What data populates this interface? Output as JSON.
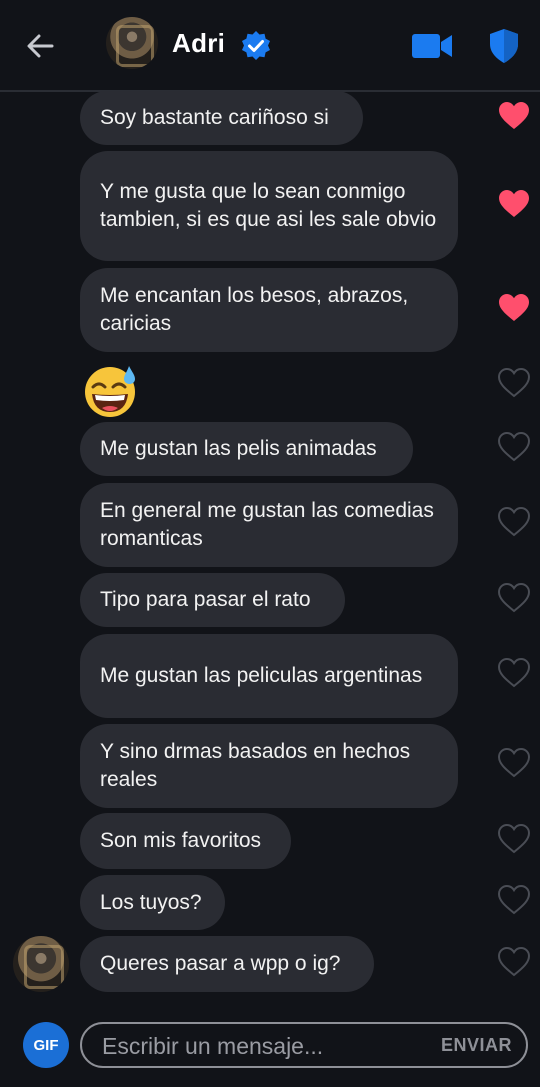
{
  "header": {
    "contact_name": "Adri",
    "verified": true,
    "accent_color": "#1b6fd6",
    "icons": [
      "back-arrow-icon",
      "verified-badge-icon",
      "video-call-icon",
      "shield-icon"
    ]
  },
  "messages": [
    {
      "text": "Soy bastante cariñoso si",
      "liked": true
    },
    {
      "text": "Y me gusta que lo sean conmigo tambien, si es que asi les sale obvio",
      "liked": true
    },
    {
      "text": "Me encantan los besos, abrazos, caricias",
      "liked": true
    },
    {
      "emoji": "grinning-face-with-sweat",
      "liked": false
    },
    {
      "text": "Me gustan las pelis animadas",
      "liked": false
    },
    {
      "text": "En general me gustan las comedias romanticas",
      "liked": false
    },
    {
      "text": "Tipo para pasar el rato",
      "liked": false
    },
    {
      "text": "Me gustan las peliculas argentinas",
      "liked": false
    },
    {
      "text": "Y sino drmas basados en hechos reales",
      "liked": false
    },
    {
      "text": "Son mis favoritos",
      "liked": false
    },
    {
      "text": "Los tuyos?",
      "liked": false
    },
    {
      "text": "Queres pasar a wpp o ig?",
      "liked": false
    }
  ],
  "colors": {
    "background": "#111318",
    "bubble": "#2a2c33",
    "heart_liked": "#ff4f6d",
    "heart_outline": "#4a4d55"
  },
  "composer": {
    "gif_label": "GIF",
    "placeholder": "Escribir un mensaje...",
    "value": "",
    "send_label": "ENVIAR"
  }
}
